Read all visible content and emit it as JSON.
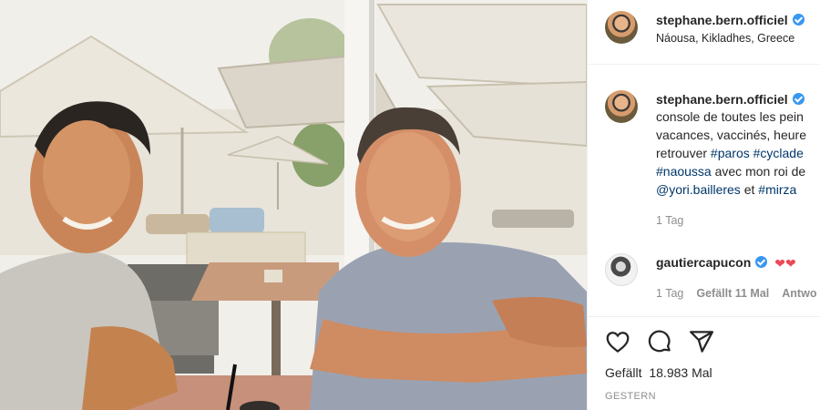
{
  "post": {
    "author": "stephane.bern.officiel",
    "location": "Náousa, Kikladhes, Greece"
  },
  "caption": {
    "author": "stephane.bern.officiel",
    "line1": "console de toutes les pein",
    "line2": "vacances, vaccinés, heure",
    "line3_text": "retrouver ",
    "tag_paros": "#paros",
    "tag_cyclades": "#cyclade",
    "tag_naoussa": "#naoussa",
    "line4_text": " avec mon roi de",
    "mention_yori": "@yori.bailleres",
    "line5_text": " et ",
    "tag_mirza": "#mirza",
    "time": "1 Tag"
  },
  "comment": {
    "author": "gautiercapucon",
    "hearts": "❤❤",
    "time": "1 Tag",
    "likes": "Gefällt 11 Mal",
    "reply": "Antwo"
  },
  "actions": {
    "like_icon": "heart-outline-icon",
    "comment_icon": "comment-bubble-icon",
    "share_icon": "paper-plane-icon"
  },
  "stats": {
    "likes_label": "Gefällt",
    "likes_count": "18.983",
    "likes_suffix": "Mal",
    "date": "GESTERN"
  },
  "colors": {
    "verified": "#3897f0",
    "hashtag": "#00376b",
    "muted": "#8e8e8e",
    "heart": "#ed4956"
  }
}
